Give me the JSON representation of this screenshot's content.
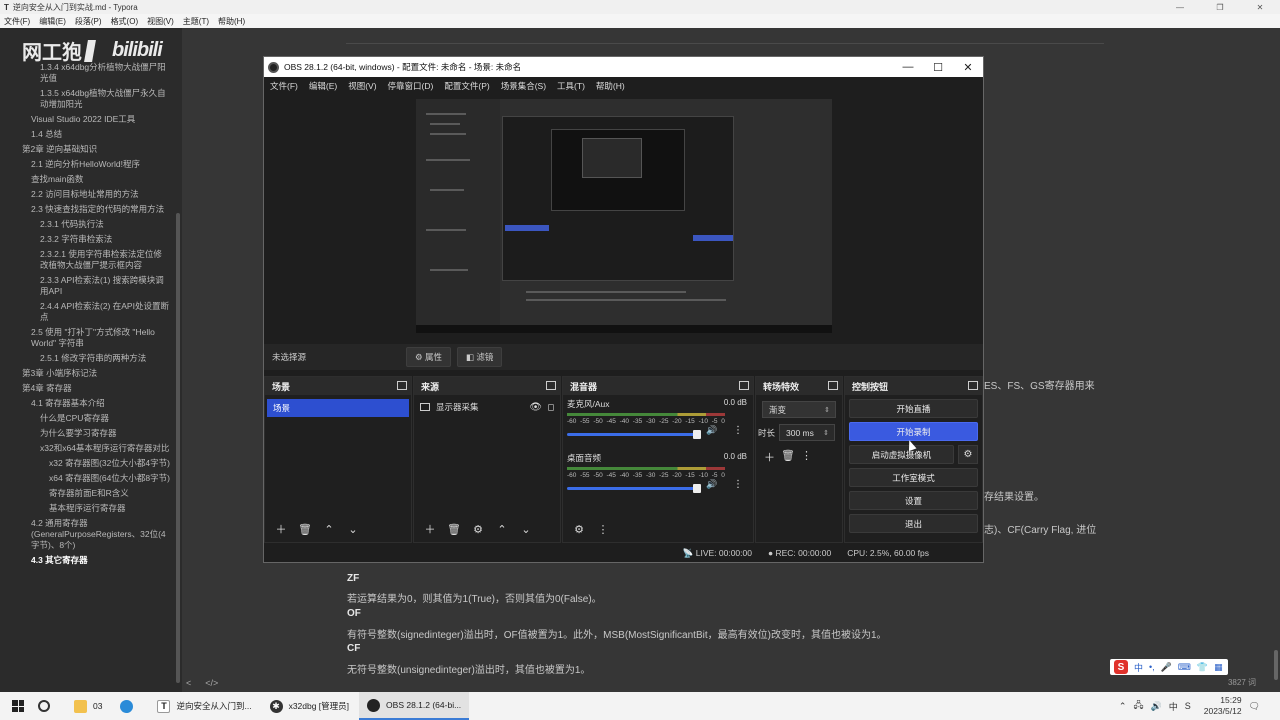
{
  "typora": {
    "title": "逆向安全从入门到实战.md - Typora",
    "menu": [
      "文件(F)",
      "编辑(E)",
      "段落(P)",
      "格式(O)",
      "视图(V)",
      "主题(T)",
      "帮助(H)"
    ],
    "toc": [
      {
        "label": "1.3.4 x64dbg分析植物大战僵尸阳光值",
        "level": 3
      },
      {
        "label": "1.3.5 x64dbg植物大战僵尸永久自动增加阳光",
        "level": 3
      },
      {
        "label": "Visual Studio 2022 IDE工具",
        "level": 2
      },
      {
        "label": "1.4 总结",
        "level": 2
      },
      {
        "label": "第2章 逆向基础知识",
        "level": 1
      },
      {
        "label": "2.1 逆向分析HelloWorld!程序",
        "level": 2
      },
      {
        "label": "查找main函数",
        "level": 2
      },
      {
        "label": "2.2 访问目标地址常用的方法",
        "level": 2
      },
      {
        "label": "2.3 快速查找指定的代码的常用方法",
        "level": 2
      },
      {
        "label": "2.3.1 代码执行法",
        "level": 3
      },
      {
        "label": "2.3.2 字符串检索法",
        "level": 3
      },
      {
        "label": "2.3.2.1 使用字符串检索法定位修改植物大战僵尸提示框内容",
        "level": 3
      },
      {
        "label": "2.3.3 API检索法(1) 搜索跨模块调用API",
        "level": 3
      },
      {
        "label": "2.4.4 API检索法(2) 在API处设置断点",
        "level": 3
      },
      {
        "label": "2.5 使用 \"打补丁\"方式修改 \"Hello World\" 字符串",
        "level": 2
      },
      {
        "label": "2.5.1 修改字符串的两种方法",
        "level": 3
      },
      {
        "label": "第3章 小端序标记法",
        "level": 1
      },
      {
        "label": "第4章 寄存器",
        "level": 1
      },
      {
        "label": "4.1 寄存器基本介绍",
        "level": 2
      },
      {
        "label": "什么是CPU寄存器",
        "level": 3
      },
      {
        "label": "为什么要学习寄存器",
        "level": 3
      },
      {
        "label": "x32和x64基本程序运行寄存器对比",
        "level": 3
      },
      {
        "label": "x32 寄存器图(32位大小都4字节)",
        "level": 4
      },
      {
        "label": "x64 寄存器图(64位大小都8字节)",
        "level": 4
      },
      {
        "label": "寄存器前面E和R含义",
        "level": 4
      },
      {
        "label": "基本程序运行寄存器",
        "level": 4
      },
      {
        "label": "4.2 通用寄存器 (GeneralPurposeRegisters、32位(4字节)、8个)",
        "level": 2
      },
      {
        "label": "4.3 其它寄存器",
        "level": 2,
        "active": true
      }
    ],
    "watermark_left": "网工狍",
    "watermark_right": "bilibili",
    "doc": {
      "partial1": "ES、FS、GS寄存器用来",
      "partial2": "存结果设置。",
      "partial3": "志)、CF(Carry Flag, 进位",
      "zf_head": "ZF",
      "zf_text": "若运算结果为0，则其值为1(True)，否则其值为0(False)。",
      "of_head": "OF",
      "of_text": "有符号整数(signedinteger)溢出时，OF值被置为1。此外，MSB(MostSignificantBit，最高有效位)改变时，其值也被设为1。",
      "cf_head": "CF",
      "cf_text": "无符号整数(unsignedinteger)溢出时，其值也被置为1。"
    },
    "footer": {
      "left": "<",
      "code": "</>"
    },
    "word_count": "3827 词"
  },
  "obs": {
    "title": "OBS 28.1.2 (64-bit, windows) - 配置文件: 未命名 - 场景: 未命名",
    "menu": [
      "文件(F)",
      "编辑(E)",
      "视图(V)",
      "停靠窗口(D)",
      "配置文件(P)",
      "场景集合(S)",
      "工具(T)",
      "帮助(H)"
    ],
    "scene_bar": {
      "no_selection": "未选择源",
      "properties": "属性",
      "filters": "滤镜"
    },
    "docks": {
      "scenes": {
        "title": "场景",
        "items": [
          "场景"
        ]
      },
      "sources": {
        "title": "来源",
        "items": [
          "显示器采集"
        ]
      },
      "mixer": {
        "title": "混音器",
        "channels": [
          {
            "name": "麦克风/Aux",
            "db": "0.0 dB",
            "level": 0.95
          },
          {
            "name": "桌面音频",
            "db": "0.0 dB",
            "level": 0.95
          }
        ],
        "scale": [
          "-60",
          "-55",
          "-50",
          "-45",
          "-40",
          "-35",
          "-30",
          "-25",
          "-20",
          "-15",
          "-10",
          "-5",
          "0"
        ]
      },
      "transitions": {
        "title": "转场特效",
        "type": "渐变",
        "duration_label": "时长",
        "duration": "300 ms"
      },
      "controls": {
        "title": "控制按钮",
        "start_stream": "开始直播",
        "start_record": "开始录制",
        "virtual_cam": "启动虚拟摄像机",
        "studio_mode": "工作室模式",
        "settings": "设置",
        "exit": "退出"
      }
    },
    "status": {
      "live": "LIVE: 00:00:00",
      "rec": "REC: 00:00:00",
      "cpu": "CPU: 2.5%, 60.00 fps"
    }
  },
  "ime": {
    "logo": "S",
    "lang": "中"
  },
  "taskbar": {
    "items": [
      {
        "label": "03",
        "icon": "folder-icon"
      },
      {
        "label": "",
        "icon": "edge-icon"
      },
      {
        "label": "逆向安全从入门到...",
        "icon": "typora-icon"
      },
      {
        "label": "x32dbg [管理员]",
        "icon": "x32dbg-icon"
      },
      {
        "label": "OBS 28.1.2 (64-bi...",
        "icon": "obs-icon"
      }
    ],
    "time": "15:29",
    "date": "2023/5/12"
  }
}
